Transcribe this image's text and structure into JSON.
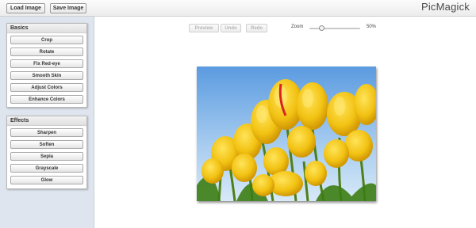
{
  "topbar": {
    "load_label": "Load Image",
    "save_label": "Save Image",
    "logo": "PicMagick"
  },
  "sidebar": {
    "basics": {
      "title": "Basics",
      "items": [
        "Crop",
        "Rotate",
        "Fix Red-eye",
        "Smooth Skin",
        "Adjust Colors",
        "Enhance Colors"
      ]
    },
    "effects": {
      "title": "Effects",
      "items": [
        "Sharpen",
        "Soften",
        "Sepia",
        "Grayscale",
        "Glow"
      ]
    }
  },
  "editor": {
    "preview_label": "Preview",
    "undo_label": "Undo",
    "redo_label": "Redo",
    "zoom_label": "Zoom",
    "zoom_value": "50%",
    "zoom_level": 0.5
  },
  "photo": {
    "subject": "yellow-tulips",
    "colors": {
      "sky": "#7fb6ea",
      "petal": "#f3c417",
      "petal_dark": "#d49a00",
      "stem": "#5b8d1e",
      "accent": "#d8241e"
    }
  }
}
